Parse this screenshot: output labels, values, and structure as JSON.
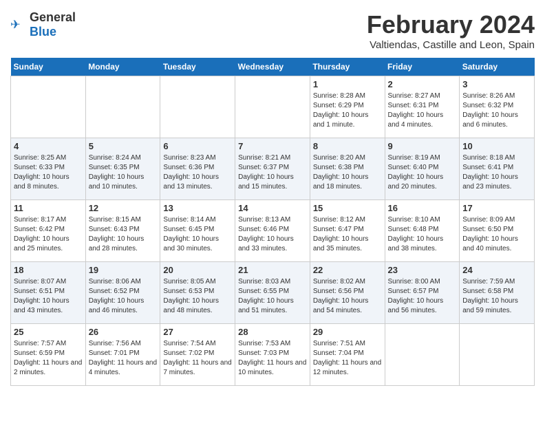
{
  "header": {
    "logo_general": "General",
    "logo_blue": "Blue",
    "month": "February 2024",
    "location": "Valtiendas, Castille and Leon, Spain"
  },
  "days_of_week": [
    "Sunday",
    "Monday",
    "Tuesday",
    "Wednesday",
    "Thursday",
    "Friday",
    "Saturday"
  ],
  "weeks": [
    {
      "days": [
        {
          "number": "",
          "empty": true
        },
        {
          "number": "",
          "empty": true
        },
        {
          "number": "",
          "empty": true
        },
        {
          "number": "",
          "empty": true
        },
        {
          "number": "1",
          "sunrise": "8:28 AM",
          "sunset": "6:29 PM",
          "daylight": "10 hours and 1 minute."
        },
        {
          "number": "2",
          "sunrise": "8:27 AM",
          "sunset": "6:31 PM",
          "daylight": "10 hours and 4 minutes."
        },
        {
          "number": "3",
          "sunrise": "8:26 AM",
          "sunset": "6:32 PM",
          "daylight": "10 hours and 6 minutes."
        }
      ]
    },
    {
      "days": [
        {
          "number": "4",
          "sunrise": "8:25 AM",
          "sunset": "6:33 PM",
          "daylight": "10 hours and 8 minutes."
        },
        {
          "number": "5",
          "sunrise": "8:24 AM",
          "sunset": "6:35 PM",
          "daylight": "10 hours and 10 minutes."
        },
        {
          "number": "6",
          "sunrise": "8:23 AM",
          "sunset": "6:36 PM",
          "daylight": "10 hours and 13 minutes."
        },
        {
          "number": "7",
          "sunrise": "8:21 AM",
          "sunset": "6:37 PM",
          "daylight": "10 hours and 15 minutes."
        },
        {
          "number": "8",
          "sunrise": "8:20 AM",
          "sunset": "6:38 PM",
          "daylight": "10 hours and 18 minutes."
        },
        {
          "number": "9",
          "sunrise": "8:19 AM",
          "sunset": "6:40 PM",
          "daylight": "10 hours and 20 minutes."
        },
        {
          "number": "10",
          "sunrise": "8:18 AM",
          "sunset": "6:41 PM",
          "daylight": "10 hours and 23 minutes."
        }
      ]
    },
    {
      "days": [
        {
          "number": "11",
          "sunrise": "8:17 AM",
          "sunset": "6:42 PM",
          "daylight": "10 hours and 25 minutes."
        },
        {
          "number": "12",
          "sunrise": "8:15 AM",
          "sunset": "6:43 PM",
          "daylight": "10 hours and 28 minutes."
        },
        {
          "number": "13",
          "sunrise": "8:14 AM",
          "sunset": "6:45 PM",
          "daylight": "10 hours and 30 minutes."
        },
        {
          "number": "14",
          "sunrise": "8:13 AM",
          "sunset": "6:46 PM",
          "daylight": "10 hours and 33 minutes."
        },
        {
          "number": "15",
          "sunrise": "8:12 AM",
          "sunset": "6:47 PM",
          "daylight": "10 hours and 35 minutes."
        },
        {
          "number": "16",
          "sunrise": "8:10 AM",
          "sunset": "6:48 PM",
          "daylight": "10 hours and 38 minutes."
        },
        {
          "number": "17",
          "sunrise": "8:09 AM",
          "sunset": "6:50 PM",
          "daylight": "10 hours and 40 minutes."
        }
      ]
    },
    {
      "days": [
        {
          "number": "18",
          "sunrise": "8:07 AM",
          "sunset": "6:51 PM",
          "daylight": "10 hours and 43 minutes."
        },
        {
          "number": "19",
          "sunrise": "8:06 AM",
          "sunset": "6:52 PM",
          "daylight": "10 hours and 46 minutes."
        },
        {
          "number": "20",
          "sunrise": "8:05 AM",
          "sunset": "6:53 PM",
          "daylight": "10 hours and 48 minutes."
        },
        {
          "number": "21",
          "sunrise": "8:03 AM",
          "sunset": "6:55 PM",
          "daylight": "10 hours and 51 minutes."
        },
        {
          "number": "22",
          "sunrise": "8:02 AM",
          "sunset": "6:56 PM",
          "daylight": "10 hours and 54 minutes."
        },
        {
          "number": "23",
          "sunrise": "8:00 AM",
          "sunset": "6:57 PM",
          "daylight": "10 hours and 56 minutes."
        },
        {
          "number": "24",
          "sunrise": "7:59 AM",
          "sunset": "6:58 PM",
          "daylight": "10 hours and 59 minutes."
        }
      ]
    },
    {
      "days": [
        {
          "number": "25",
          "sunrise": "7:57 AM",
          "sunset": "6:59 PM",
          "daylight": "11 hours and 2 minutes."
        },
        {
          "number": "26",
          "sunrise": "7:56 AM",
          "sunset": "7:01 PM",
          "daylight": "11 hours and 4 minutes."
        },
        {
          "number": "27",
          "sunrise": "7:54 AM",
          "sunset": "7:02 PM",
          "daylight": "11 hours and 7 minutes."
        },
        {
          "number": "28",
          "sunrise": "7:53 AM",
          "sunset": "7:03 PM",
          "daylight": "11 hours and 10 minutes."
        },
        {
          "number": "29",
          "sunrise": "7:51 AM",
          "sunset": "7:04 PM",
          "daylight": "11 hours and 12 minutes."
        },
        {
          "number": "",
          "empty": true
        },
        {
          "number": "",
          "empty": true
        }
      ]
    }
  ]
}
